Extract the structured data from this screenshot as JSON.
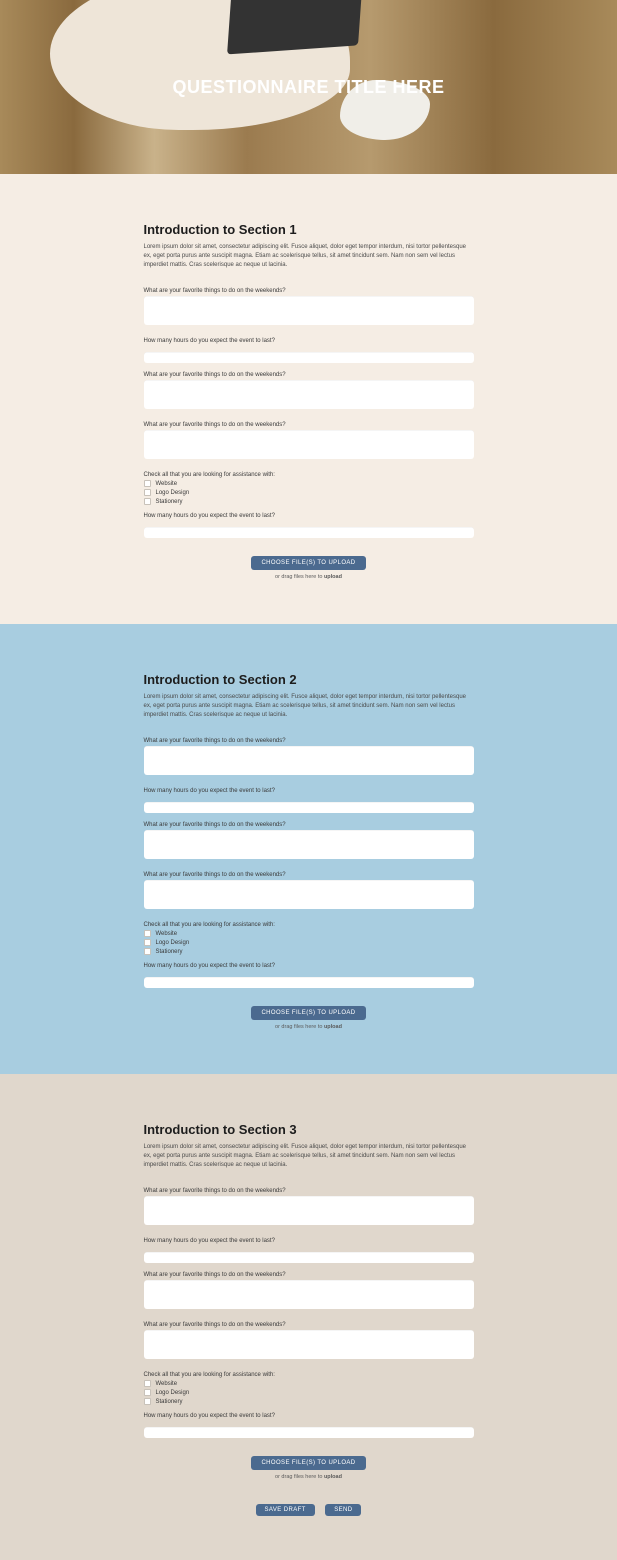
{
  "hero": {
    "title": "QUESTIONNAIRE TITLE HERE"
  },
  "sections": [
    {
      "title": "Introduction to Section 1",
      "desc": "Lorem ipsum dolor sit amet, consectetur adipiscing elit. Fusce aliquet, dolor eget tempor interdum, nisi tortor pellentesque ex, eget porta purus ante suscipit magna. Etiam ac scelerisque tellus, sit amet tincidunt sem. Nam non sem vel lectus imperdiet mattis. Cras scelerisque ac neque ut lacinia.",
      "q_textarea1": "What are your favorite things to do on the weekends?",
      "q_text1": "How many hours do you expect the event to last?",
      "q_textarea2": "What are your favorite things to do on the weekends?",
      "q_textarea3": "What are your favorite things to do on the weekends?",
      "check_heading": "Check all that you are looking for assistance with:",
      "check_opts": [
        "Website",
        "Logo Design",
        "Stationery"
      ],
      "q_text2": "How many hours do you expect the event to last?",
      "upload_btn": "CHOOSE FILE(S) TO UPLOAD",
      "upload_hint_pre": "or drag files here to ",
      "upload_hint_bold": "upload"
    },
    {
      "title": "Introduction to Section 2",
      "desc": "Lorem ipsum dolor sit amet, consectetur adipiscing elit. Fusce aliquet, dolor eget tempor interdum, nisi tortor pellentesque ex, eget porta purus ante suscipit magna. Etiam ac scelerisque tellus, sit amet tincidunt sem. Nam non sem vel lectus imperdiet mattis. Cras scelerisque ac neque ut lacinia.",
      "q_textarea1": "What are your favorite things to do on the weekends?",
      "q_text1": "How many hours do you expect the event to last?",
      "q_textarea2": "What are your favorite things to do on the weekends?",
      "q_textarea3": "What are your favorite things to do on the weekends?",
      "check_heading": "Check all that you are looking for assistance with:",
      "check_opts": [
        "Website",
        "Logo Design",
        "Stationery"
      ],
      "q_text2": "How many hours do you expect the event to last?",
      "upload_btn": "CHOOSE FILE(S) TO UPLOAD",
      "upload_hint_pre": "or drag files here to ",
      "upload_hint_bold": "upload"
    },
    {
      "title": "Introduction to Section 3",
      "desc": "Lorem ipsum dolor sit amet, consectetur adipiscing elit. Fusce aliquet, dolor eget tempor interdum, nisi tortor pellentesque ex, eget porta purus ante suscipit magna. Etiam ac scelerisque tellus, sit amet tincidunt sem. Nam non sem vel lectus imperdiet mattis. Cras scelerisque ac neque ut lacinia.",
      "q_textarea1": "What are your favorite things to do on the weekends?",
      "q_text1": "How many hours do you expect the event to last?",
      "q_textarea2": "What are your favorite things to do on the weekends?",
      "q_textarea3": "What are your favorite things to do on the weekends?",
      "check_heading": "Check all that you are looking for assistance with:",
      "check_opts": [
        "Website",
        "Logo Design",
        "Stationery"
      ],
      "q_text2": "How many hours do you expect the event to last?",
      "upload_btn": "CHOOSE FILE(S) TO UPLOAD",
      "upload_hint_pre": "or drag files here to ",
      "upload_hint_bold": "upload"
    }
  ],
  "footer": {
    "save_draft": "SAVE DRAFT",
    "send": "SEND"
  }
}
